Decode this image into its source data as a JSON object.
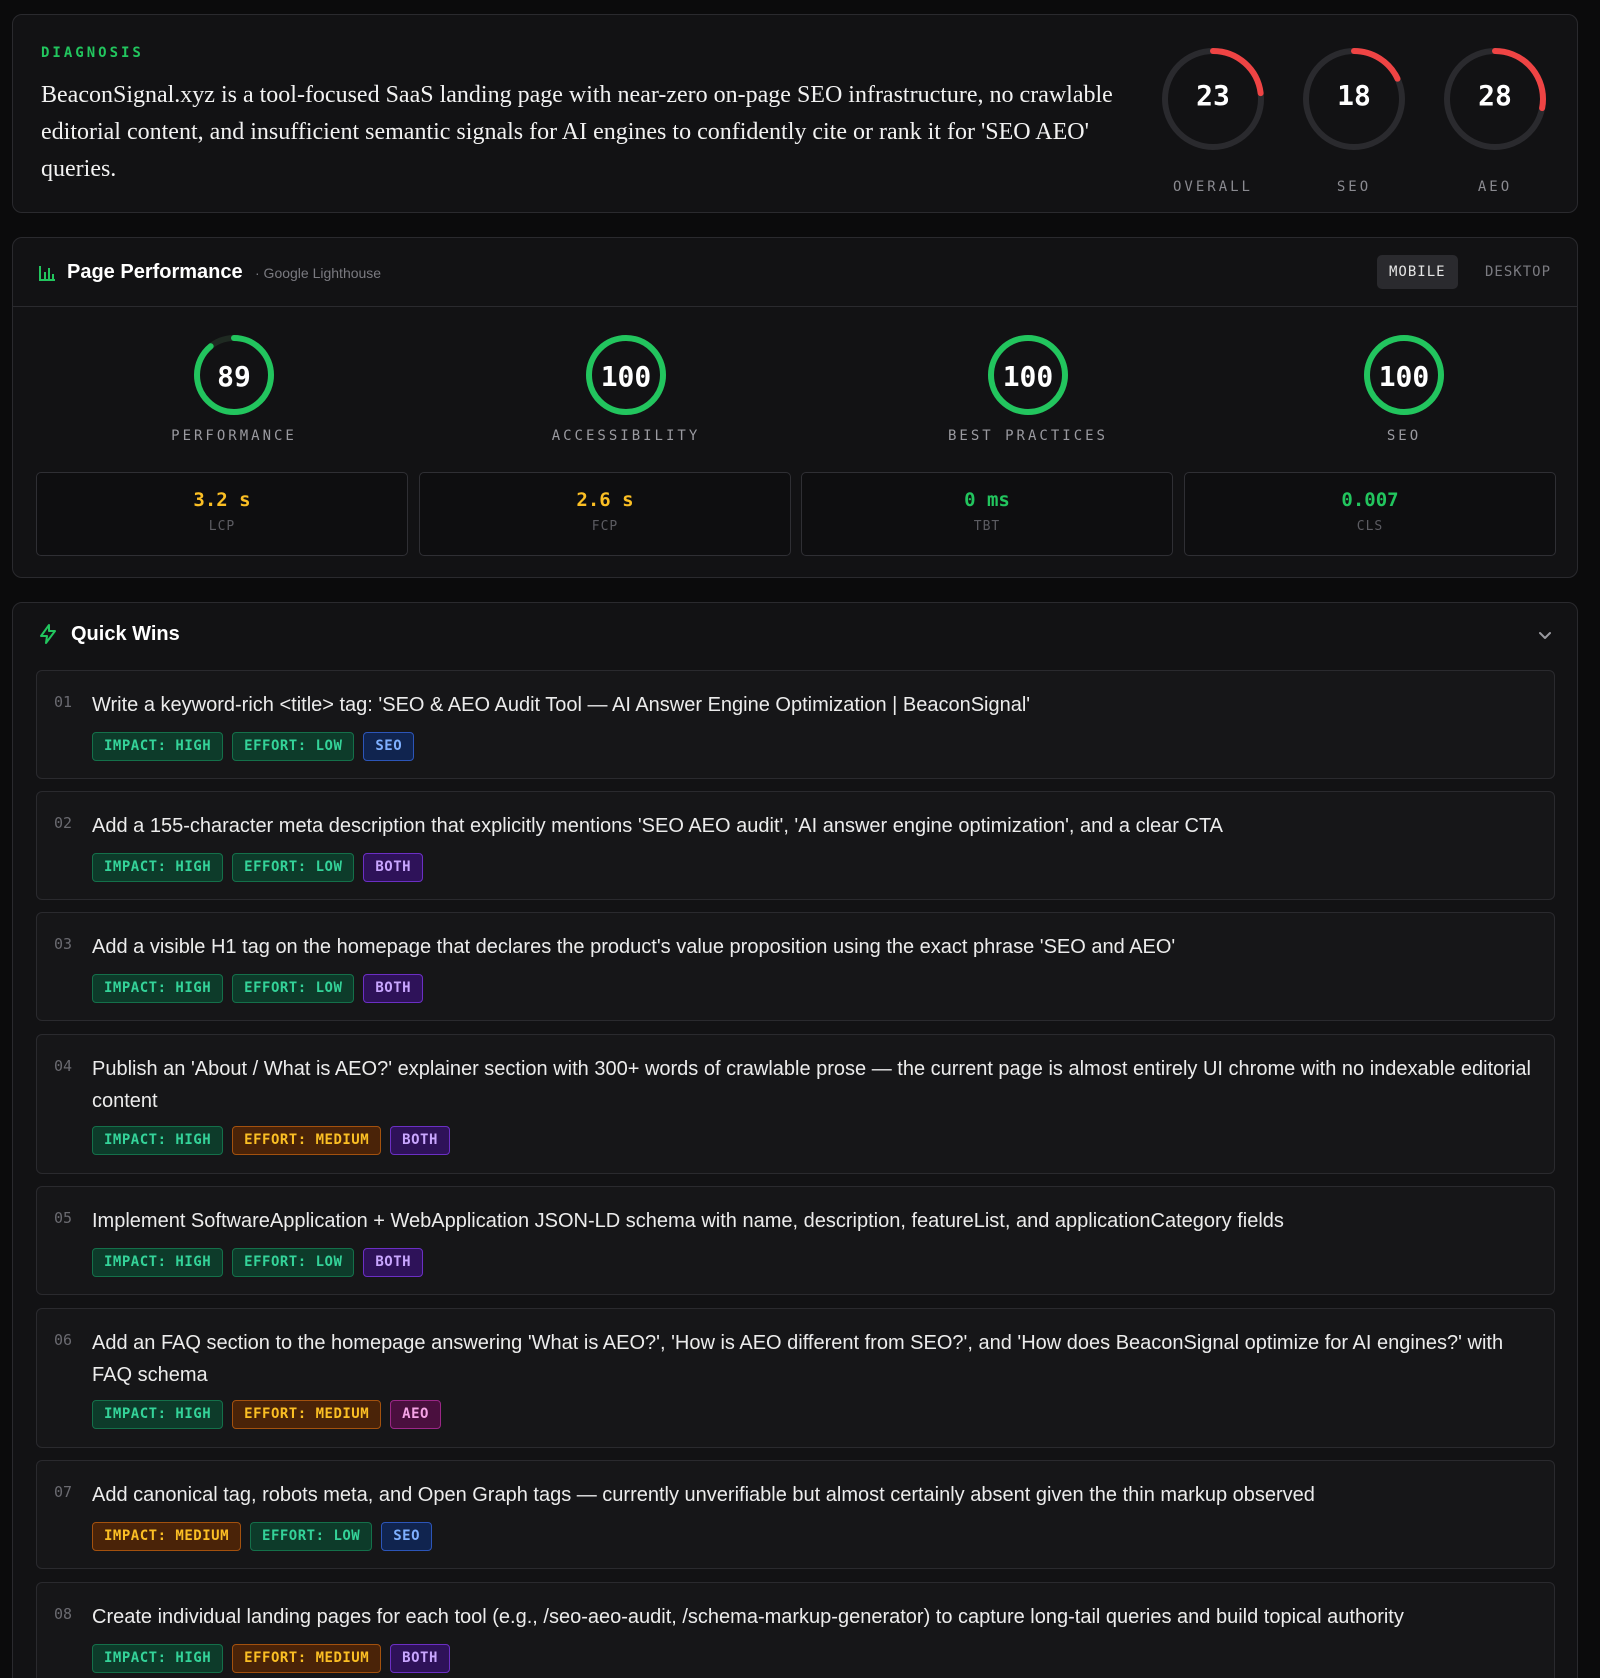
{
  "diagnosis": {
    "label": "DIAGNOSIS",
    "text": "BeaconSignal.xyz is a tool-focused SaaS landing page with near-zero on-page SEO infrastructure, no crawlable editorial content, and insufficient semantic signals for AI engines to confidently cite or rank it for 'SEO AEO' queries.",
    "scores": [
      {
        "label": "OVERALL",
        "value": "23",
        "percent": 23
      },
      {
        "label": "SEO",
        "value": "18",
        "percent": 18
      },
      {
        "label": "AEO",
        "value": "28",
        "percent": 28
      }
    ],
    "score_color": "#ef4444"
  },
  "performance": {
    "icon": "bar-chart-icon",
    "title": "Page Performance",
    "subtitle": "· Google Lighthouse",
    "toggle": {
      "mobile": "MOBILE",
      "desktop": "DESKTOP",
      "selected": "MOBILE"
    },
    "gauge_color": "#22c55e",
    "gauges": [
      {
        "label": "PERFORMANCE",
        "value": "89",
        "percent": 89
      },
      {
        "label": "ACCESSIBILITY",
        "value": "100",
        "percent": 100
      },
      {
        "label": "BEST PRACTICES",
        "value": "100",
        "percent": 100
      },
      {
        "label": "SEO",
        "value": "100",
        "percent": 100
      }
    ],
    "metrics": [
      {
        "value": "3.2 s",
        "name": "LCP",
        "color": "#fbbf24"
      },
      {
        "value": "2.6 s",
        "name": "FCP",
        "color": "#fbbf24"
      },
      {
        "value": "0 ms",
        "name": "TBT",
        "color": "#22c55e"
      },
      {
        "value": "0.007",
        "name": "CLS",
        "color": "#22c55e"
      }
    ]
  },
  "quick_wins": {
    "icon": "lightning-icon",
    "title": "Quick Wins",
    "items": [
      {
        "num": "01",
        "text": "Write a keyword-rich <title> tag: 'SEO & AEO Audit Tool — AI Answer Engine Optimization | BeaconSignal'",
        "impact": "IMPACT: HIGH",
        "effort": "EFFORT: LOW",
        "scope": "SEO"
      },
      {
        "num": "02",
        "text": "Add a 155-character meta description that explicitly mentions 'SEO AEO audit', 'AI answer engine optimization', and a clear CTA",
        "impact": "IMPACT: HIGH",
        "effort": "EFFORT: LOW",
        "scope": "BOTH"
      },
      {
        "num": "03",
        "text": "Add a visible H1 tag on the homepage that declares the product's value proposition using the exact phrase 'SEO and AEO'",
        "impact": "IMPACT: HIGH",
        "effort": "EFFORT: LOW",
        "scope": "BOTH"
      },
      {
        "num": "04",
        "text": "Publish an 'About / What is AEO?' explainer section with 300+ words of crawlable prose — the current page is almost entirely UI chrome with no indexable editorial content",
        "impact": "IMPACT: HIGH",
        "effort": "EFFORT: MEDIUM",
        "scope": "BOTH"
      },
      {
        "num": "05",
        "text": "Implement SoftwareApplication + WebApplication JSON-LD schema with name, description, featureList, and applicationCategory fields",
        "impact": "IMPACT: HIGH",
        "effort": "EFFORT: LOW",
        "scope": "BOTH"
      },
      {
        "num": "06",
        "text": "Add an FAQ section to the homepage answering 'What is AEO?', 'How is AEO different from SEO?', and 'How does BeaconSignal optimize for AI engines?' with FAQ schema",
        "impact": "IMPACT: HIGH",
        "effort": "EFFORT: MEDIUM",
        "scope": "AEO"
      },
      {
        "num": "07",
        "text": "Add canonical tag, robots meta, and Open Graph tags — currently unverifiable but almost certainly absent given the thin markup observed",
        "impact": "IMPACT: MEDIUM",
        "effort": "EFFORT: LOW",
        "scope": "SEO"
      },
      {
        "num": "08",
        "text": "Create individual landing pages for each tool (e.g., /seo-aeo-audit, /schema-markup-generator) to capture long-tail queries and build topical authority",
        "impact": "IMPACT: HIGH",
        "effort": "EFFORT: MEDIUM",
        "scope": "BOTH"
      }
    ]
  }
}
